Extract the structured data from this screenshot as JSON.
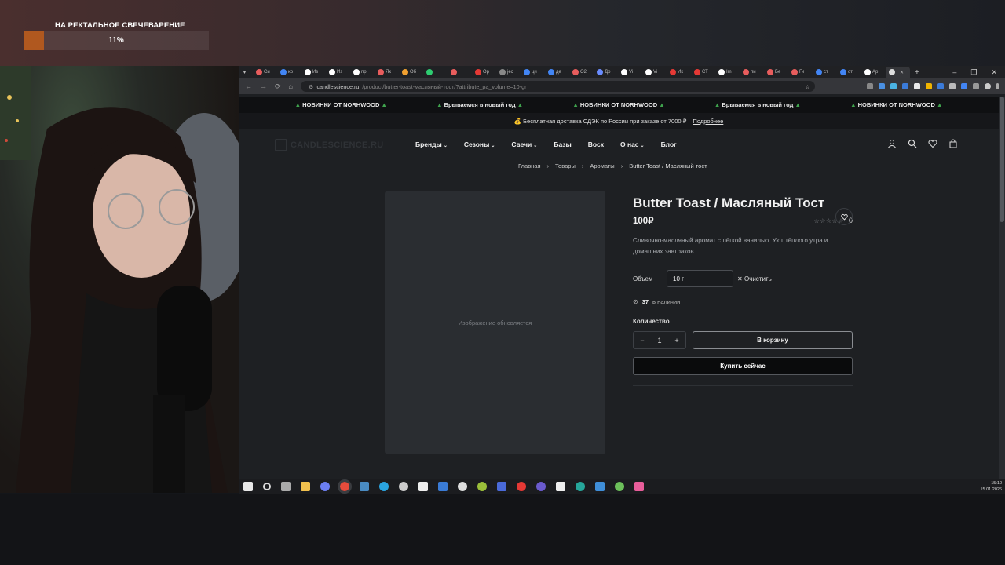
{
  "stream": {
    "goal_title": "НА РЕКТАЛЬНОЕ СВЕЧЕВАРЕНИЕ",
    "goal_percent_label": "11%",
    "goal_progress": 0.11
  },
  "browser": {
    "url_host": "candlescience.ru",
    "url_path": "/product/butter-toast-масляный-тост/?attribute_pa_volume=10-gr",
    "tabs": [
      {
        "label": "Си",
        "color": "#e85d5d"
      },
      {
        "label": "ко",
        "color": "#4285f4"
      },
      {
        "label": "Из",
        "color": "#ffffff"
      },
      {
        "label": "Из",
        "color": "#ffffff"
      },
      {
        "label": "пр",
        "color": "#ffffff"
      },
      {
        "label": "Як",
        "color": "#e85d5d"
      },
      {
        "label": "Об",
        "color": "#f0a030"
      },
      {
        "label": "",
        "color": "#2ecc71"
      },
      {
        "label": "",
        "color": "#e85d5d"
      },
      {
        "label": "Ор",
        "color": "#e53935"
      },
      {
        "label": "jec",
        "color": "#888888"
      },
      {
        "label": "ци",
        "color": "#4285f4"
      },
      {
        "label": "де",
        "color": "#4285f4"
      },
      {
        "label": "О2",
        "color": "#e85d5d"
      },
      {
        "label": "Др",
        "color": "#6a8cff"
      },
      {
        "label": "Vi",
        "color": "#ffffff"
      },
      {
        "label": "Vi",
        "color": "#ffffff"
      },
      {
        "label": "Ик",
        "color": "#e53935"
      },
      {
        "label": "СТ",
        "color": "#e53935"
      },
      {
        "label": "Im",
        "color": "#ffffff"
      },
      {
        "label": "пи",
        "color": "#e85d5d"
      },
      {
        "label": "Бе",
        "color": "#e85d5d"
      },
      {
        "label": "Ги",
        "color": "#e85d5d"
      },
      {
        "label": "ст",
        "color": "#4285f4"
      },
      {
        "label": "от",
        "color": "#4285f4"
      },
      {
        "label": "Ар",
        "color": "#ffffff"
      }
    ]
  },
  "site": {
    "marquee": [
      {
        "text": "НОВИНКИ ОТ NORHWOOD",
        "decor": true
      },
      {
        "text": "Врываемся в новый год",
        "decor": true
      },
      {
        "text": "НОВИНКИ ОТ NORHWOOD",
        "decor": true
      },
      {
        "text": "Врываемся в новый год",
        "decor": true
      },
      {
        "text": "НОВИНКИ ОТ NORHWOOD",
        "decor": true
      }
    ],
    "shipping_text": "Бесплатная доставка СДЭК по России при заказе от 7000 ₽",
    "shipping_link": "Подробнее",
    "logo": "CANDLESCIENCE.RU",
    "nav": [
      {
        "label": "Бренды",
        "dropdown": true
      },
      {
        "label": "Сезоны",
        "dropdown": true
      },
      {
        "label": "Свечи",
        "dropdown": true
      },
      {
        "label": "Базы",
        "dropdown": false
      },
      {
        "label": "Воск",
        "dropdown": false
      },
      {
        "label": "О нас",
        "dropdown": true
      },
      {
        "label": "Блог",
        "dropdown": false
      }
    ],
    "breadcrumb": [
      "Главная",
      "Товары",
      "Ароматы",
      "Butter Toast / Масляный тост"
    ]
  },
  "product": {
    "image_placeholder": "Изображение обновляется",
    "title": "Butter Toast / Масляный Тост",
    "price": "100₽",
    "rating_count": "0",
    "description": "Сливочно-масляный аромат с лёгкой ванилью. Уют тёплого утра и домашних завтраков.",
    "variation_label": "Объем",
    "variation_value": "10 г",
    "clear_label": "Очистить",
    "stock_count": "37",
    "stock_text": "в наличии",
    "qty_label": "Количество",
    "qty_value": "1",
    "add_to_cart": "В корзину",
    "buy_now": "Купить сейчас"
  },
  "system": {
    "time": "15:10",
    "date": "15.01.2026"
  }
}
